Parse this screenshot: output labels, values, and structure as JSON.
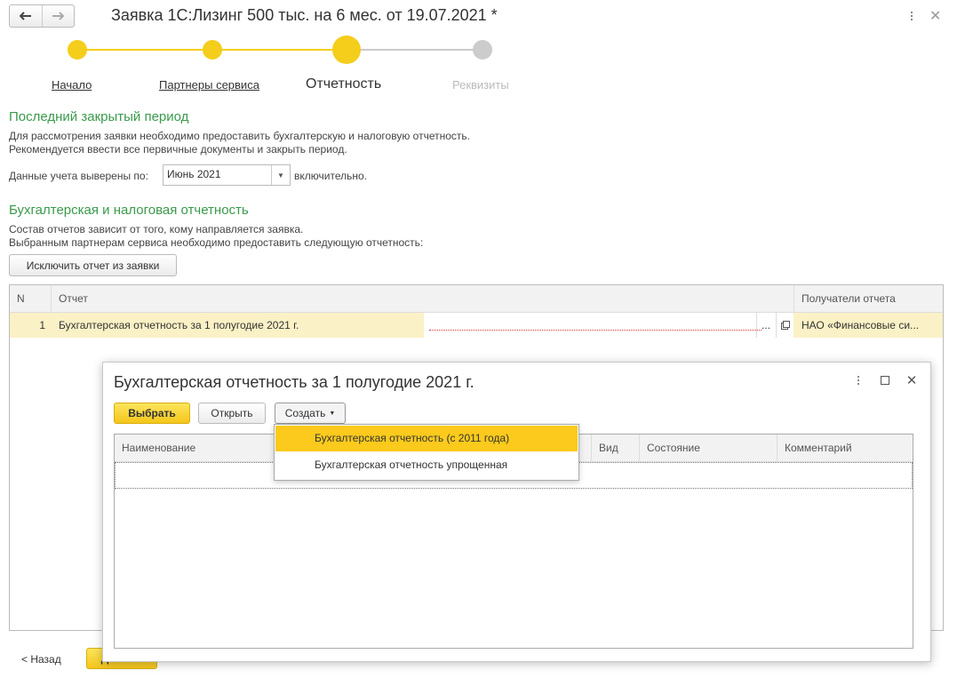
{
  "header": {
    "title": "Заявка 1С:Лизинг 500 тыс. на 6 мес. от 19.07.2021 *",
    "back_icon": "arrow-left-icon",
    "forward_icon": "arrow-right-icon"
  },
  "steps": [
    {
      "label": "Начало",
      "state": "done"
    },
    {
      "label": "Партнеры сервиса",
      "state": "done"
    },
    {
      "label": "Отчетность",
      "state": "current"
    },
    {
      "label": "Реквизиты",
      "state": "disabled"
    }
  ],
  "period": {
    "heading": "Последний закрытый период",
    "line1": "Для рассмотрения заявки необходимо предоставить бухгалтерскую и налоговую отчетность.",
    "line2": "Рекомендуется ввести все первичные документы и закрыть период.",
    "field_label": "Данные учета выверены по:",
    "field_value": "Июнь 2021",
    "suffix": "включительно."
  },
  "reports": {
    "heading": "Бухгалтерская и налоговая отчетность",
    "line1": "Состав отчетов зависит от того, кому направляется заявка.",
    "line2": "Выбранным партнерам сервиса необходимо предоставить следующую отчетность:",
    "exclude_button": "Исключить отчет из заявки",
    "columns": {
      "n": "N",
      "report": "Отчет",
      "recipients": "Получатели отчета"
    },
    "rows": [
      {
        "n": "1",
        "report": "Бухгалтерская отчетность за 1 полугодие 2021 г.",
        "ellipsis": "...",
        "recipients": "НАО «Финансовые си..."
      }
    ]
  },
  "footer": {
    "back": "< Назад",
    "next": "Далее >"
  },
  "modal": {
    "title": "Бухгалтерская отчетность за 1 полугодие 2021 г.",
    "select_button": "Выбрать",
    "open_button": "Открыть",
    "create_button": "Создать",
    "columns": {
      "name": "Наименование",
      "kind": "Вид",
      "state": "Состояние",
      "comment": "Комментарий"
    },
    "dropdown": [
      "Бухгалтерская отчетность (с 2011 года)",
      "Бухгалтерская отчетность упрощенная"
    ]
  },
  "colors": {
    "accent_yellow": "#f5cd1b",
    "heading_green": "#3a9a4b",
    "row_highlight": "#fbf1c6"
  }
}
